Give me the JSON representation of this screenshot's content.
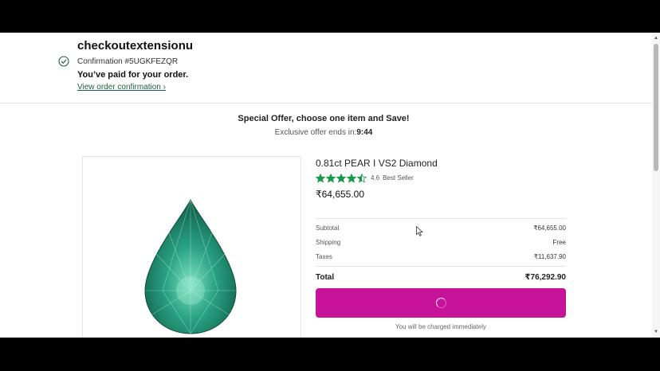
{
  "header": {
    "store_name": "checkoutextensionu",
    "confirmation": "Confirmation #5UGKFEZQR",
    "paid_message": "You’ve paid for your order.",
    "view_link": "View order confirmation ›"
  },
  "offer": {
    "title": "Special Offer, choose one item and Save!",
    "ends_label": "Exclusive offer ends in:",
    "countdown": "9:44"
  },
  "product": {
    "title": "0.81ct PEAR I VS2 Diamond",
    "rating": "4.6",
    "rating_value": 4.5,
    "rating_max": 5,
    "badge": "Best Seller",
    "price": "₹64,655.00",
    "image_icon": "pear-diamond-image"
  },
  "summary": {
    "subtotal_label": "Subtotal",
    "subtotal_value": "₹64,655.00",
    "shipping_label": "Shipping",
    "shipping_value": "Free",
    "taxes_label": "Taxes",
    "taxes_value": "₹11,637.90",
    "total_label": "Total",
    "total_value": "₹76,292.90"
  },
  "pay_button": {
    "state": "loading",
    "icon": "spinner-icon"
  },
  "charged_note": "You will be charged immediately",
  "colors": {
    "accent": "#c7139a",
    "star": "#1a9b4b",
    "link": "#1f5e3d"
  }
}
